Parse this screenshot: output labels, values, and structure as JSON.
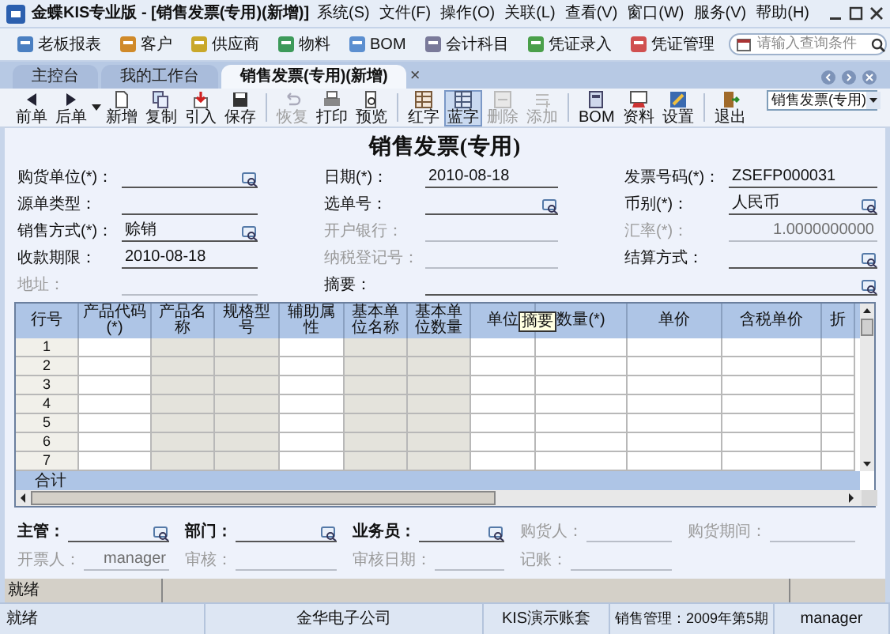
{
  "window": {
    "title": "金蝶KIS专业版 - [销售发票(专用)(新增)]"
  },
  "menu": [
    "系统(S)",
    "文件(F)",
    "操作(O)",
    "关联(L)",
    "查看(V)",
    "窗口(W)",
    "服务(V)",
    "帮助(H)"
  ],
  "quick_bar": [
    {
      "label": "老板报表"
    },
    {
      "label": "客户"
    },
    {
      "label": "供应商"
    },
    {
      "label": "物料"
    },
    {
      "label": "BOM"
    },
    {
      "label": "会计科目"
    },
    {
      "label": "凭证录入"
    },
    {
      "label": "凭证管理"
    }
  ],
  "search": {
    "placeholder": "请输入查询条件"
  },
  "tabs": [
    {
      "label": "主控台",
      "selected": false
    },
    {
      "label": "我的工作台",
      "selected": false
    },
    {
      "label": "销售发票(专用)(新增)",
      "selected": true,
      "closable": true
    }
  ],
  "tab_close": "×",
  "toolbar": [
    {
      "label": "前单",
      "disabled": false,
      "pressed": false
    },
    {
      "label": "后单",
      "disabled": false,
      "pressed": false,
      "dropdown": true
    },
    {
      "label": "新增",
      "disabled": false,
      "pressed": false
    },
    {
      "label": "复制",
      "disabled": false,
      "pressed": false
    },
    {
      "label": "引入",
      "disabled": false,
      "pressed": false
    },
    {
      "label": "保存",
      "disabled": false,
      "pressed": false
    },
    {
      "label": "恢复",
      "disabled": true,
      "pressed": false
    },
    {
      "label": "打印",
      "disabled": false,
      "pressed": false
    },
    {
      "label": "预览",
      "disabled": false,
      "pressed": false
    },
    {
      "label": "红字",
      "disabled": false,
      "pressed": false
    },
    {
      "label": "蓝字",
      "disabled": false,
      "pressed": true
    },
    {
      "label": "删除",
      "disabled": true,
      "pressed": false
    },
    {
      "label": "添加",
      "disabled": true,
      "pressed": false
    },
    {
      "label": "BOM",
      "disabled": false,
      "pressed": false
    },
    {
      "label": "资料",
      "disabled": false,
      "pressed": false
    },
    {
      "label": "设置",
      "disabled": false,
      "pressed": false
    },
    {
      "label": "退出",
      "disabled": false,
      "pressed": false
    }
  ],
  "view_select": {
    "value": "销售发票(专用)"
  },
  "form_title": "销售发票(专用)",
  "header_fields": [
    [
      {
        "label": "购货单位(*)：",
        "disabled": false,
        "lookup": true
      },
      {
        "label": "日期(*)：",
        "value": "2010-08-18",
        "disabled": false
      },
      {
        "label": "发票号码(*)：",
        "value": "ZSEFP000031",
        "disabled": false
      }
    ],
    [
      {
        "label": "源单类型：",
        "disabled": false
      },
      {
        "label": "选单号：",
        "disabled": false,
        "lookup": true
      },
      {
        "label": "币别(*)：",
        "value": "人民币",
        "disabled": false,
        "lookup": true
      }
    ],
    [
      {
        "label": "销售方式(*)：",
        "value": "赊销",
        "disabled": false,
        "lookup": true
      },
      {
        "label": "开户银行：",
        "disabled": true
      },
      {
        "label": "汇率(*)：",
        "value": "1.0000000000",
        "disabled": true
      }
    ],
    [
      {
        "label": "收款期限：",
        "value": "2010-08-18",
        "disabled": false
      },
      {
        "label": "纳税登记号：",
        "disabled": true
      },
      {
        "label": "结算方式：",
        "disabled": false,
        "lookup": true
      }
    ],
    [
      {
        "label": "地址：",
        "disabled": true
      },
      {
        "label": "摘要：",
        "disabled": false,
        "lookup": true,
        "wide": true
      }
    ]
  ],
  "table": {
    "columns": [
      {
        "label": "行号"
      },
      {
        "label": "产品代码(*)",
        "shaded": false
      },
      {
        "label": "产品名称",
        "shaded": true
      },
      {
        "label": "规格型号",
        "shaded": true
      },
      {
        "label": "辅助属性",
        "shaded": false
      },
      {
        "label": "基本单位名称",
        "shaded": true
      },
      {
        "label": "基本单位数量",
        "shaded": true
      },
      {
        "label": "单位",
        "shaded": false
      },
      {
        "label": "数量(*)",
        "shaded": false
      },
      {
        "label": "单价",
        "shaded": false
      },
      {
        "label": "含税单价",
        "shaded": false
      },
      {
        "label": "折",
        "shaded": false
      }
    ],
    "rows": [
      "1",
      "2",
      "3",
      "4",
      "5",
      "6",
      "7"
    ],
    "total_label": "合计",
    "tooltip": "摘要"
  },
  "footer_fields": [
    [
      {
        "label": "主管：",
        "disabled": false,
        "lookup": true
      },
      {
        "label": "部门：",
        "disabled": false,
        "lookup": true
      },
      {
        "label": "业务员：",
        "disabled": false,
        "lookup": true
      },
      {
        "label": "购货人：",
        "disabled": true
      },
      {
        "label": "购货期间：",
        "disabled": true
      }
    ],
    [
      {
        "label": "开票人：",
        "value": "manager",
        "disabled": true
      },
      {
        "label": "审核：",
        "disabled": true
      },
      {
        "label": "审核日期：",
        "disabled": true
      },
      {
        "label": "记账：",
        "disabled": true
      }
    ]
  ],
  "inner_status": "就绪",
  "status_bar": [
    "就绪",
    "金华电子公司",
    "KIS演示账套",
    "销售管理：2009年第5期",
    "manager"
  ]
}
